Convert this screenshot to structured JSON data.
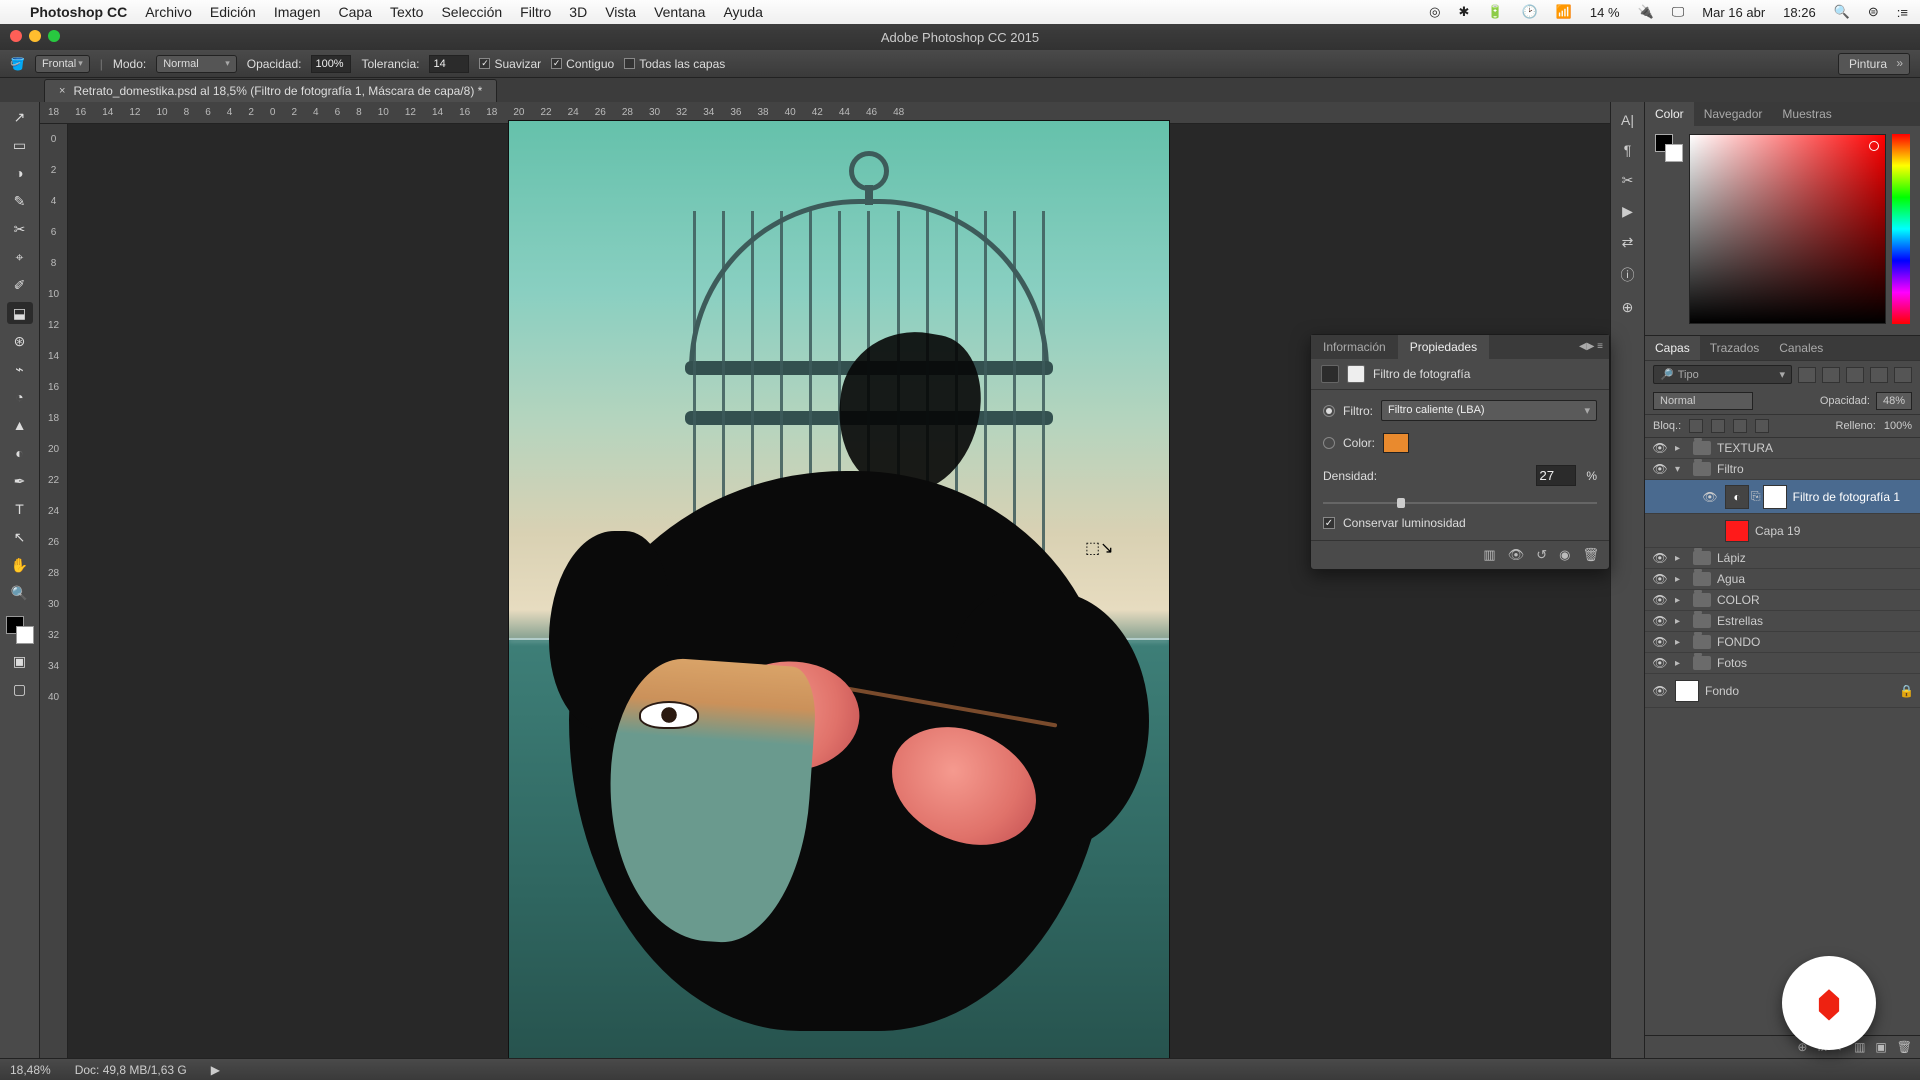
{
  "menubar": {
    "apple": "",
    "app": "Photoshop CC",
    "items": [
      "Archivo",
      "Edición",
      "Imagen",
      "Capa",
      "Texto",
      "Selección",
      "Filtro",
      "3D",
      "Vista",
      "Ventana",
      "Ayuda"
    ],
    "status_icons": [
      "◎",
      "✱",
      "🔋",
      "🕑",
      "📶",
      "14 %",
      "🔌",
      "🖵"
    ],
    "date": "Mar 16 abr",
    "time": "18:26",
    "right_icons": [
      "🔍",
      "⊜",
      ":≡"
    ]
  },
  "titlebar": {
    "title": "Adobe Photoshop CC 2015"
  },
  "options": {
    "tool_icon": "🪣",
    "fill_mode": "Frontal",
    "mode_label": "Modo:",
    "mode_value": "Normal",
    "opacity_label": "Opacidad:",
    "opacity_value": "100%",
    "tolerance_label": "Tolerancia:",
    "tolerance_value": "14",
    "antialias": "Suavizar",
    "antialias_on": true,
    "contiguous": "Contiguo",
    "contiguous_on": true,
    "all_layers": "Todas las capas",
    "all_layers_on": false,
    "workspace": "Pintura"
  },
  "tab": {
    "close": "×",
    "label": "Retrato_domestika.psd al 18,5% (Filtro de fotografía 1, Máscara de capa/8) *"
  },
  "ruler": {
    "h": [
      "18",
      "16",
      "14",
      "12",
      "10",
      "8",
      "6",
      "4",
      "2",
      "0",
      "2",
      "4",
      "6",
      "8",
      "10",
      "12",
      "14",
      "16",
      "18",
      "20",
      "22",
      "24",
      "26",
      "28",
      "30",
      "32",
      "34",
      "36",
      "38",
      "40",
      "42",
      "44",
      "46",
      "48"
    ],
    "v": [
      "0",
      "2",
      "4",
      "6",
      "8",
      "10",
      "12",
      "14",
      "16",
      "18",
      "20",
      "22",
      "24",
      "26",
      "28",
      "30",
      "32",
      "34",
      "40"
    ]
  },
  "tools": [
    "↗",
    "▭",
    "◑",
    "✎",
    "✂",
    "⌖",
    "✐",
    "⬓",
    "⊛",
    "⌁",
    "◔",
    "▲",
    "◐",
    "✒",
    "T",
    "↖",
    "✋",
    "🔍"
  ],
  "float": {
    "tab_info": "Información",
    "tab_props": "Propiedades",
    "header": "Filtro de fotografía",
    "filter_label": "Filtro:",
    "filter_value": "Filtro caliente (LBA)",
    "color_label": "Color:",
    "color_hex": "#e98a2e",
    "density_label": "Densidad:",
    "density_value": "27",
    "density_unit": "%",
    "preserve": "Conservar luminosidad",
    "preserve_on": true
  },
  "colorpanel": {
    "tab_color": "Color",
    "tab_nav": "Navegador",
    "tab_swatch": "Muestras"
  },
  "layerspanel": {
    "tab_layers": "Capas",
    "tab_paths": "Trazados",
    "tab_channels": "Canales",
    "search_icon": "🔎",
    "kind": "Tipo",
    "blend": "Normal",
    "opacity_label": "Opacidad:",
    "opacity": "48%",
    "lock_label": "Bloq.:",
    "fill_label": "Relleno:",
    "fill": "100%",
    "rows": [
      {
        "eye": true,
        "type": "folder",
        "name": "TEXTURA",
        "indent": 0
      },
      {
        "eye": true,
        "type": "folder",
        "name": "Filtro",
        "indent": 0,
        "open": true,
        "sel": false
      },
      {
        "eye": true,
        "type": "adj",
        "name": "Filtro de fotografía 1",
        "indent": 2,
        "sel": true
      },
      {
        "eye": false,
        "type": "color",
        "swatch": "#ff1a1a",
        "name": "Capa 19",
        "indent": 2
      },
      {
        "eye": true,
        "type": "folder",
        "name": "Lápiz",
        "indent": 0
      },
      {
        "eye": true,
        "type": "folder",
        "name": "Agua",
        "indent": 0
      },
      {
        "eye": true,
        "type": "folder",
        "name": "COLOR",
        "indent": 0
      },
      {
        "eye": true,
        "type": "folder",
        "name": "Estrellas",
        "indent": 0
      },
      {
        "eye": true,
        "type": "folder",
        "name": "FONDO",
        "indent": 0
      },
      {
        "eye": true,
        "type": "folder",
        "name": "Fotos",
        "indent": 0
      },
      {
        "eye": true,
        "type": "bg",
        "name": "Fondo",
        "indent": 0,
        "locked": true
      }
    ],
    "ftr_icons": [
      "⊕",
      "fx",
      "◐",
      "▥",
      "▣",
      "🗑"
    ]
  },
  "iconcol": [
    "A|",
    "¶",
    "✂",
    "▶",
    "⇄",
    "ⓘ",
    "⊕"
  ],
  "status": {
    "zoom": "18,48%",
    "doc": "Doc: 49,8 MB/1,63 G",
    "arrow": "▶"
  }
}
